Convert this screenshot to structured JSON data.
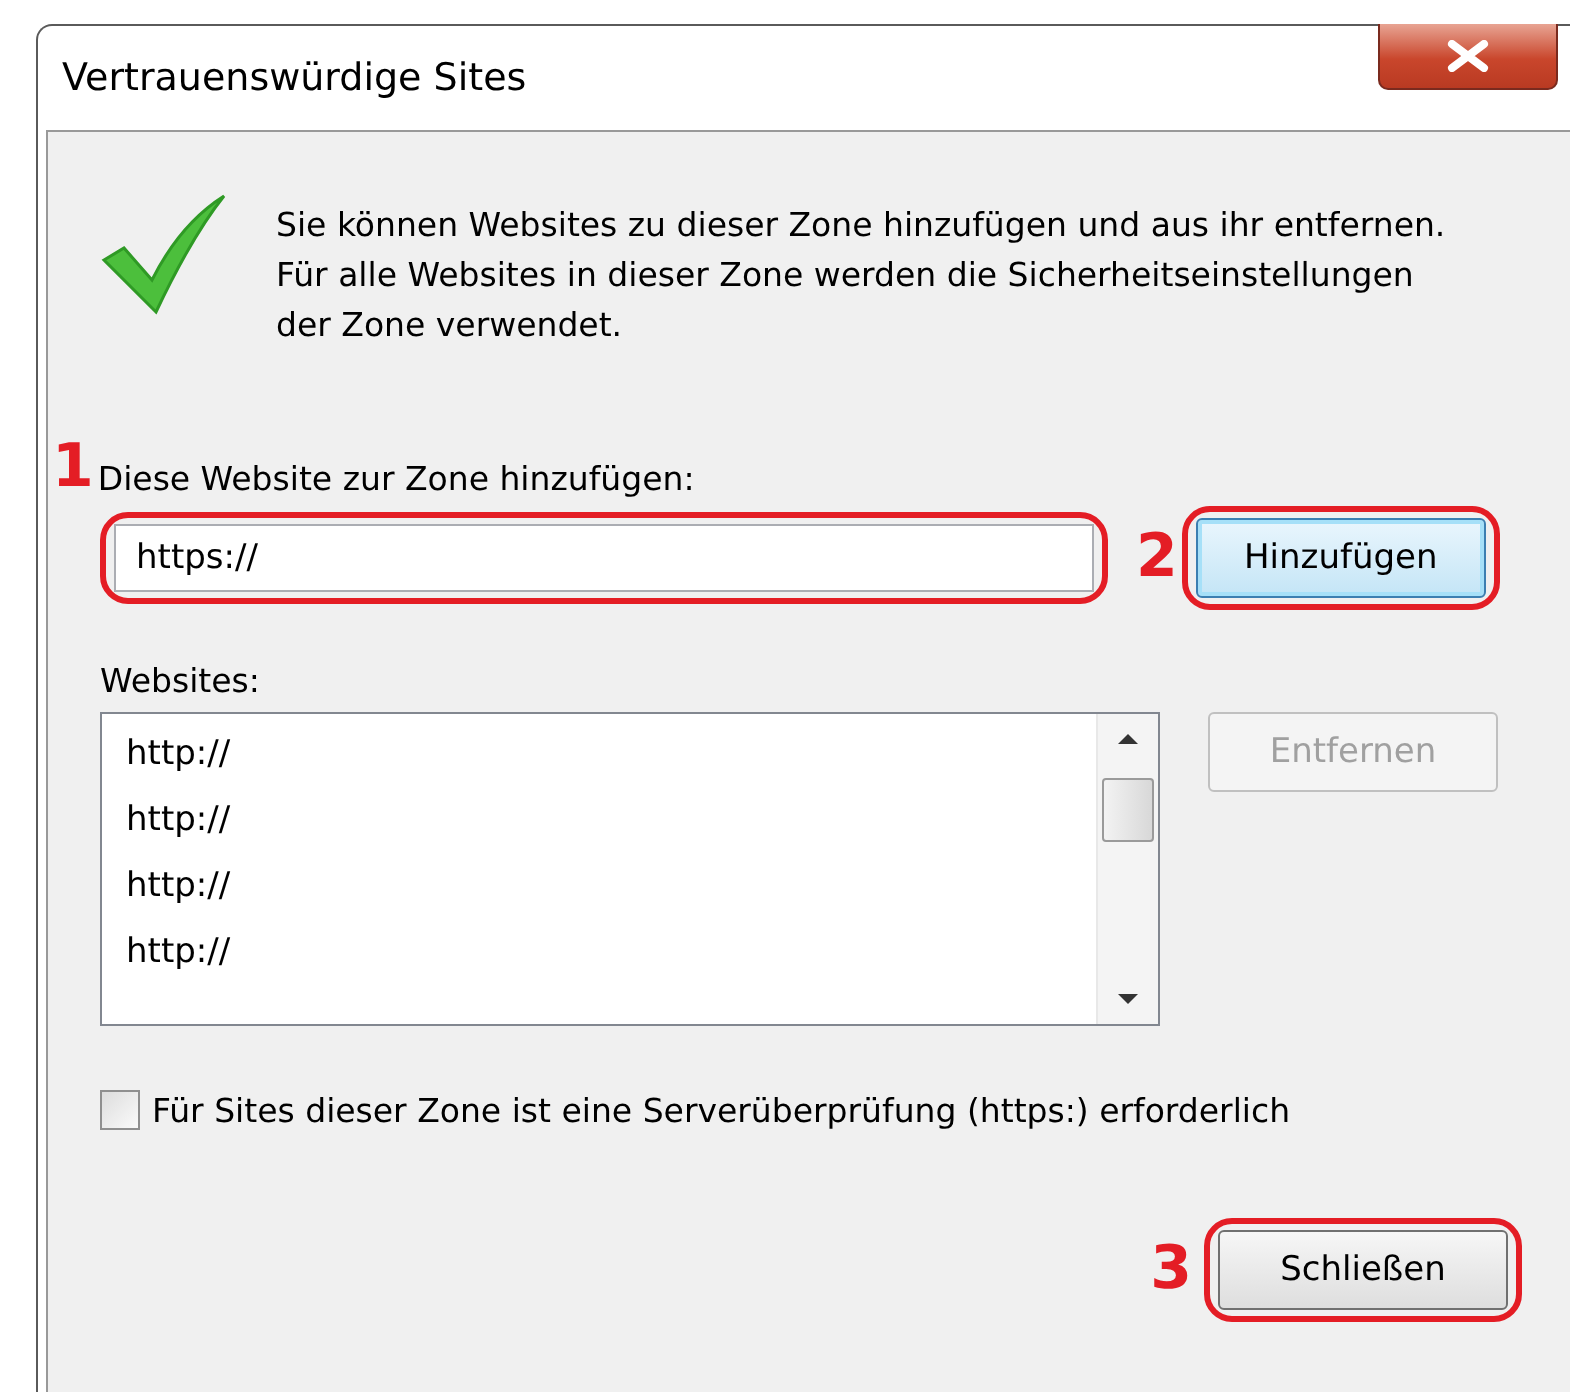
{
  "window": {
    "title": "Vertrauenswürdige Sites"
  },
  "info": {
    "text": "Sie können Websites zu dieser Zone hinzufügen und aus ihr entfernen. Für alle Websites in dieser Zone werden die Sicherheitseinstellungen der Zone verwendet."
  },
  "add": {
    "label": "Diese Website zur Zone hinzufügen:",
    "annotation": "1",
    "field": {
      "value": "https://"
    },
    "button": {
      "label": "Hinzufügen",
      "annotation": "2",
      "focused": true
    }
  },
  "websites": {
    "label": "Websites:",
    "items": [
      {
        "text": "http://"
      },
      {
        "text": "http://"
      },
      {
        "text": "http://"
      },
      {
        "text": "http://"
      }
    ],
    "remove_button": {
      "label": "Entfernen",
      "disabled": true
    }
  },
  "https_check": {
    "label": "Für Sites dieser Zone ist eine Serverüberprüfung (https:) erforderlich",
    "checked": false
  },
  "close_button": {
    "label": "Schließen",
    "annotation": "3"
  }
}
